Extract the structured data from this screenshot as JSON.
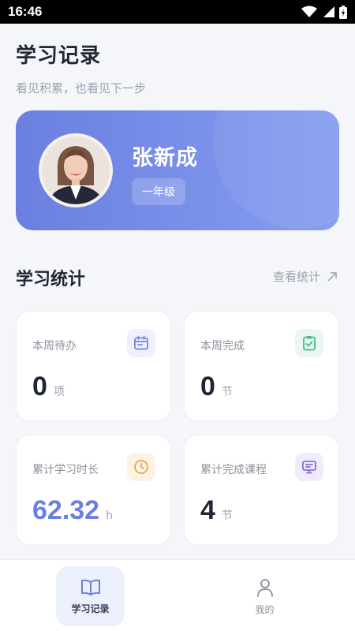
{
  "status_bar": {
    "time": "16:46"
  },
  "header": {
    "title": "学习记录",
    "subtitle": "看见积累，也看见下一步"
  },
  "profile": {
    "name": "张新成",
    "grade": "一年级"
  },
  "stats_section": {
    "title": "学习统计",
    "view_link": "查看统计"
  },
  "stats": [
    {
      "label": "本周待办",
      "value": "0",
      "unit": "项",
      "icon": "calendar-icon",
      "icon_bg": "#eef1fc",
      "icon_color": "#7486e2"
    },
    {
      "label": "本周完成",
      "value": "0",
      "unit": "节",
      "icon": "clipboard-check-icon",
      "icon_bg": "#e8f7f1",
      "icon_color": "#45b88a"
    },
    {
      "label": "累计学习时长",
      "value": "62.32",
      "unit": "h",
      "icon": "clock-icon",
      "icon_bg": "#fdf3e4",
      "icon_color": "#e7a844"
    },
    {
      "label": "累计完成课程",
      "value": "4",
      "unit": "节",
      "icon": "presentation-icon",
      "icon_bg": "#f1ecfb",
      "icon_color": "#8a6cd7"
    }
  ],
  "nav": [
    {
      "label": "学习记录",
      "icon": "book-icon",
      "active": true
    },
    {
      "label": "我的",
      "icon": "user-icon",
      "active": false
    }
  ],
  "colors": {
    "accent": "#6b7fe0",
    "background": "#f4f6fa"
  }
}
